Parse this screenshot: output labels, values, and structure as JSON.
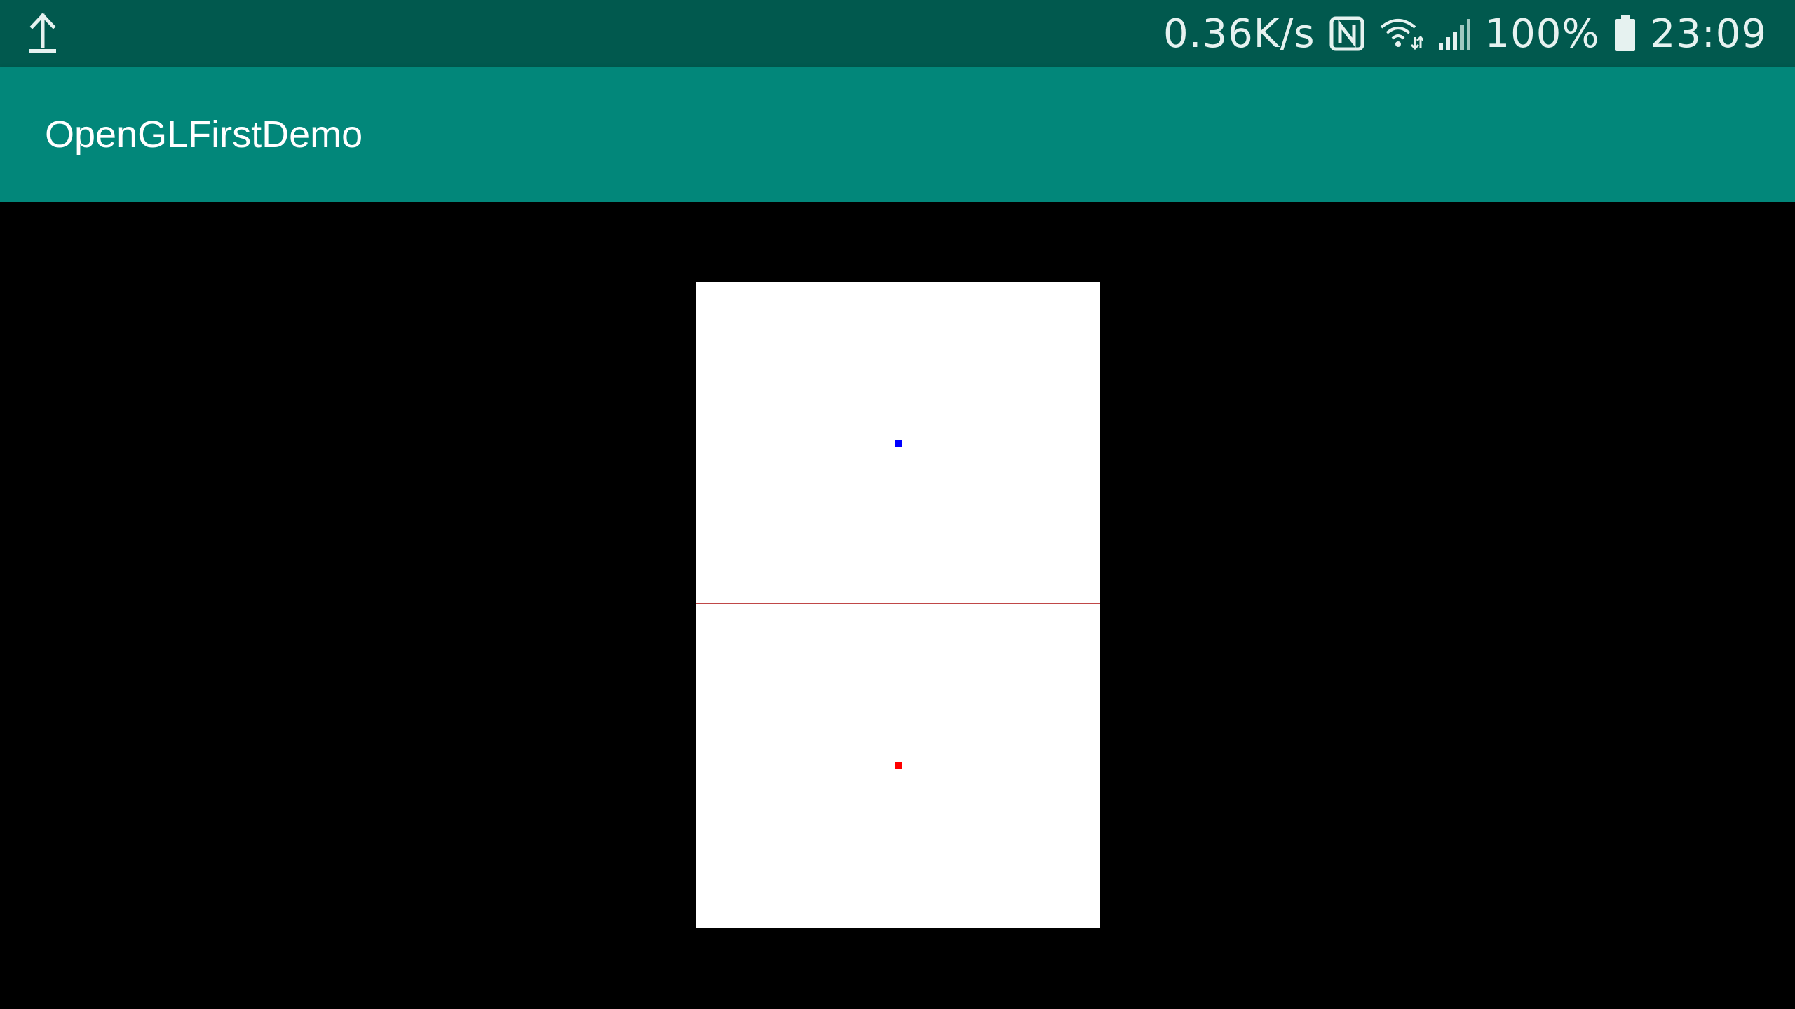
{
  "status_bar": {
    "network_speed": "0.36K/s",
    "battery": "100%",
    "time": "23:09",
    "icons": [
      "upload-icon",
      "nfc-icon",
      "wifi-icon",
      "signal-icon",
      "battery-icon"
    ]
  },
  "app_bar": {
    "title": "OpenGLFirstDemo"
  },
  "gl_canvas": {
    "background": "#FFFFFF",
    "line_color": "#C04848",
    "points": [
      {
        "name": "blue-point",
        "color": "#0000FF"
      },
      {
        "name": "red-point",
        "color": "#FF0000"
      }
    ]
  },
  "colors": {
    "status_bar": "#01594E",
    "app_bar": "#02877A",
    "background": "#000000"
  }
}
